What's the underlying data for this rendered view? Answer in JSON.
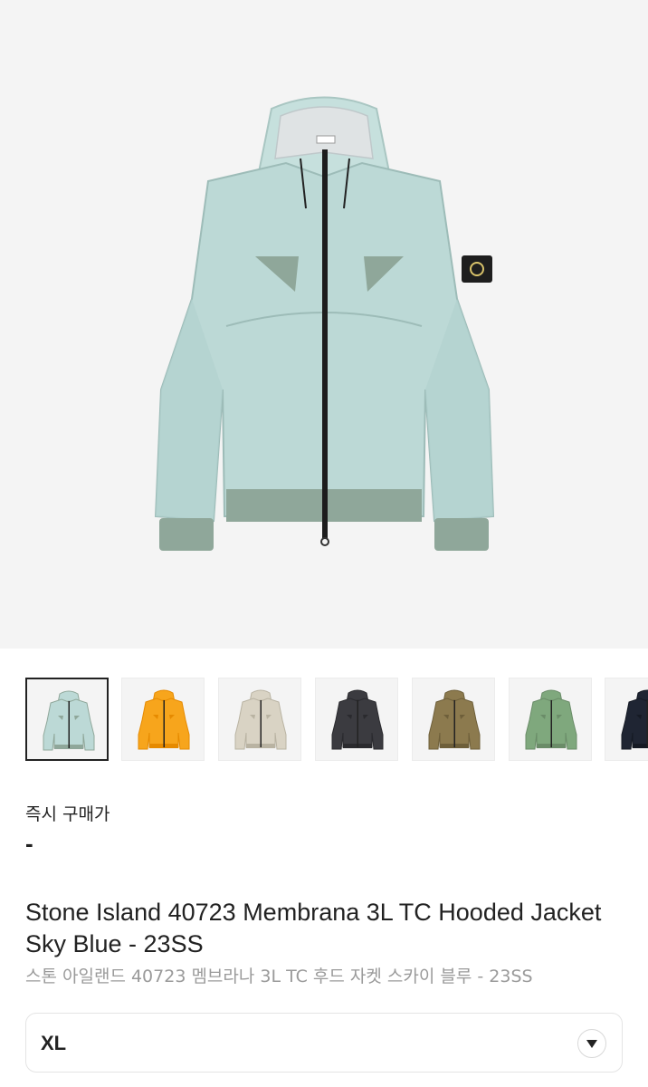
{
  "product": {
    "title": "Stone Island 40723 Membrana 3L TC Hooded Jacket Sky Blue - 23SS",
    "subtitle": "스톤 아일랜드 40723 멤브라나 3L TC 후드 자켓 스카이 블루 - 23SS",
    "main_image_icon": "jacket-image",
    "main_color": "#bcd9d6"
  },
  "thumbnails": [
    {
      "color": "#bcd9d6",
      "trim": "#8fa79a",
      "active": true
    },
    {
      "color": "#f7a51c",
      "trim": "#e68a00",
      "active": false
    },
    {
      "color": "#d9d3c4",
      "trim": "#b9b3a2",
      "active": false
    },
    {
      "color": "#3b3b40",
      "trim": "#2a2a2e",
      "active": false
    },
    {
      "color": "#8c7a4e",
      "trim": "#6e5f3a",
      "active": false
    },
    {
      "color": "#7fa87d",
      "trim": "#6a8c68",
      "active": false
    },
    {
      "color": "#1f2533",
      "trim": "#151a24",
      "active": false
    }
  ],
  "price": {
    "label": "즉시 구매가",
    "value": "-"
  },
  "size_selector": {
    "value": "XL",
    "icon": "chevron-down-icon"
  }
}
